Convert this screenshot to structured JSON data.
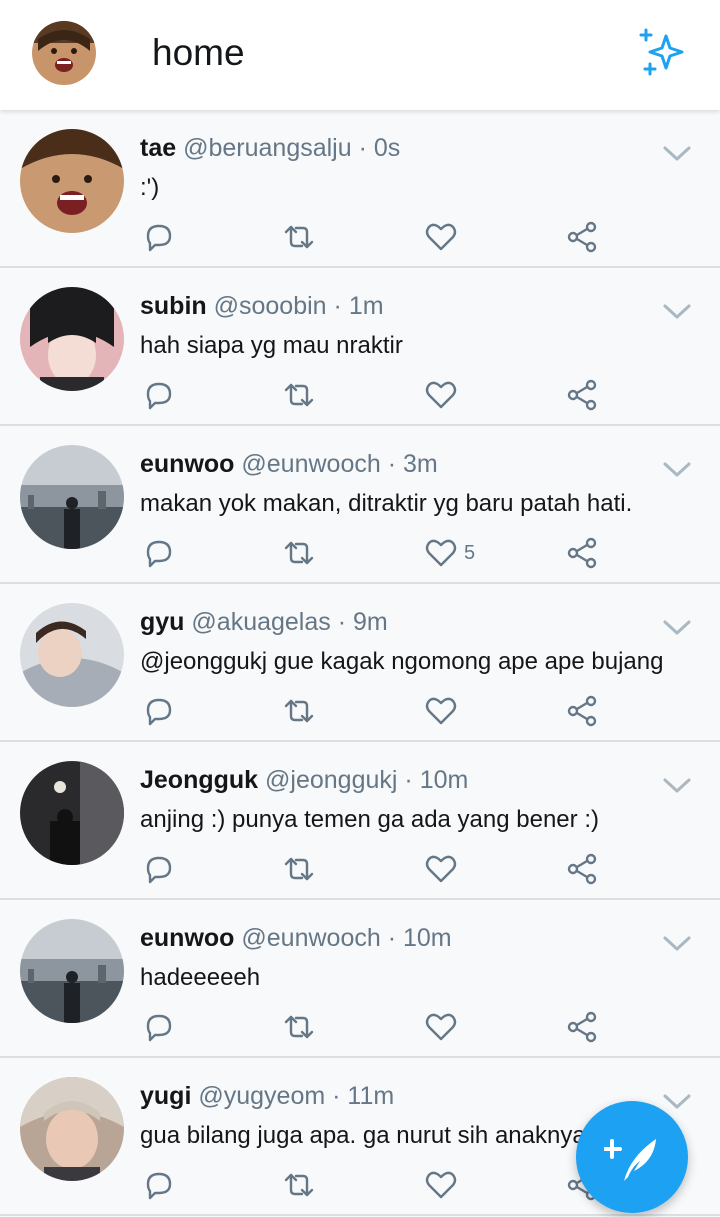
{
  "header": {
    "title": "home",
    "accent_color": "#1da1f2",
    "left_icon": "profile-avatar",
    "right_icon": "sparkle-icon"
  },
  "tweets": [
    {
      "name": "tae",
      "handle": "@beruangsalju",
      "dot": "·",
      "time": "0s",
      "text": ":')",
      "likes": ""
    },
    {
      "name": "subin",
      "handle": "@sooobin",
      "dot": "·",
      "time": "1m",
      "text": "hah siapa yg mau nraktir",
      "likes": ""
    },
    {
      "name": "eunwoo",
      "handle": "@eunwooch",
      "dot": "·",
      "time": "3m",
      "text": "makan yok makan, ditraktir yg baru patah hati.",
      "likes": "5"
    },
    {
      "name": "gyu",
      "handle": "@akuagelas",
      "dot": "·",
      "time": "9m",
      "text": "@jeonggukj gue kagak ngomong ape ape bujang",
      "likes": ""
    },
    {
      "name": "Jeongguk",
      "handle": "@jeonggukj",
      "dot": "·",
      "time": "10m",
      "text": "anjing :) punya temen ga ada yang bener :)",
      "likes": ""
    },
    {
      "name": "eunwoo",
      "handle": "@eunwooch",
      "dot": "·",
      "time": "10m",
      "text": "hadeeeeeh",
      "likes": ""
    },
    {
      "name": "yugi",
      "handle": "@yugyeom",
      "dot": "·",
      "time": "11m",
      "text": "gua bilang juga apa. ga nurut sih anaknya",
      "likes": ""
    }
  ],
  "icons": {
    "reply": "reply-icon",
    "retweet": "retweet-icon",
    "like": "heart-icon",
    "share": "share-icon",
    "more": "chevron-down-icon",
    "compose": "compose-feather-icon"
  }
}
